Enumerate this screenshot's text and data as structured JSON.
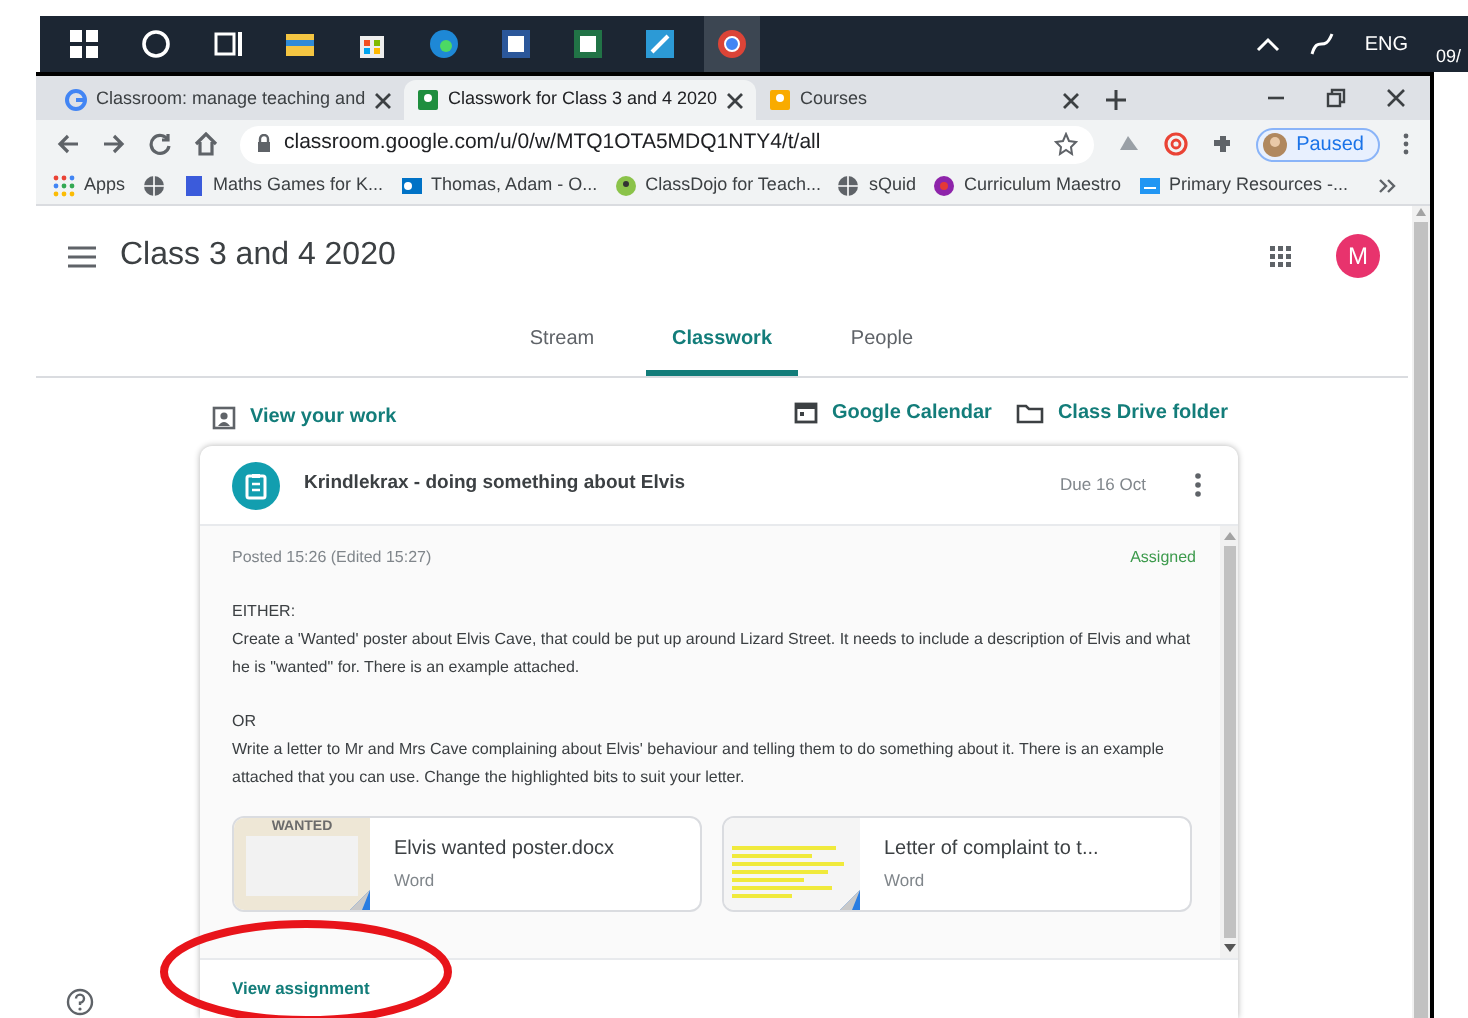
{
  "taskbar": {
    "apps": [
      {
        "kind": "start",
        "selected": false
      },
      {
        "kind": "search",
        "selected": false
      },
      {
        "kind": "taskview",
        "selected": false
      },
      {
        "kind": "explorer",
        "selected": false
      },
      {
        "kind": "store",
        "selected": false
      },
      {
        "kind": "edge",
        "selected": false
      },
      {
        "kind": "word",
        "selected": false
      },
      {
        "kind": "excel",
        "selected": false
      },
      {
        "kind": "notes",
        "selected": false
      },
      {
        "kind": "chrome",
        "selected": true
      }
    ],
    "language": "ENG",
    "clock": "09/"
  },
  "browser": {
    "tabs": [
      {
        "title": "Classroom: manage teaching and",
        "kind": "google",
        "selected": false
      },
      {
        "title": "Classwork for Class 3 and 4 2020",
        "kind": "classroom",
        "selected": true
      },
      {
        "title": "Courses",
        "kind": "courses",
        "selected": false
      }
    ],
    "address": "classroom.google.com/u/0/w/MTQ1OTA5MDQ1NTY4/t/all",
    "profile": "Paused",
    "bookmarks": [
      {
        "label": "Apps",
        "kind": "apps"
      },
      {
        "kind": "globe"
      },
      {
        "label": "Maths Games for K...",
        "kind": "maths"
      },
      {
        "label": "Thomas, Adam - O...",
        "kind": "outlook"
      },
      {
        "label": "ClassDojo for Teach...",
        "kind": "dojo"
      },
      {
        "label": "sQuid",
        "kind": "globe"
      },
      {
        "label": "Curriculum Maestro",
        "kind": "maestro"
      },
      {
        "label": "Primary Resources -...",
        "kind": "primary"
      }
    ]
  },
  "page": {
    "class_title": "Class 3 and 4 2020",
    "avatar": "M",
    "nav_tabs": [
      {
        "label": "Stream",
        "selected": false
      },
      {
        "label": "Classwork",
        "selected": true
      },
      {
        "label": "People",
        "selected": false
      }
    ],
    "view_your_work": "View your work",
    "google_calendar": "Google Calendar",
    "class_drive_folder": "Class Drive folder",
    "assignment": {
      "title": "Krindlekrax - doing something about Elvis",
      "due": "Due 16 Oct",
      "posted": "Posted 15:26 (Edited 15:27)",
      "status": "Assigned",
      "paragraphs": [
        {
          "heading": "EITHER:",
          "text": "Create a 'Wanted' poster about Elvis Cave, that could be put up around Lizard Street. It needs to include a description of Elvis and what he is \"wanted\" for. There is an example attached."
        },
        {
          "heading": "OR",
          "text": "Write a letter to Mr and Mrs Cave complaining about Elvis' behaviour and telling them to do something about it. There is an example attached that you can use. Change the highlighted bits to suit your letter."
        }
      ],
      "attachments": [
        {
          "name": "Elvis wanted poster.docx",
          "type": "Word",
          "kind": "poster",
          "thumbnail_text": "WANTED"
        },
        {
          "name": "Letter of complaint to t...",
          "type": "Word",
          "kind": "letter"
        }
      ],
      "action": "View assignment"
    }
  }
}
